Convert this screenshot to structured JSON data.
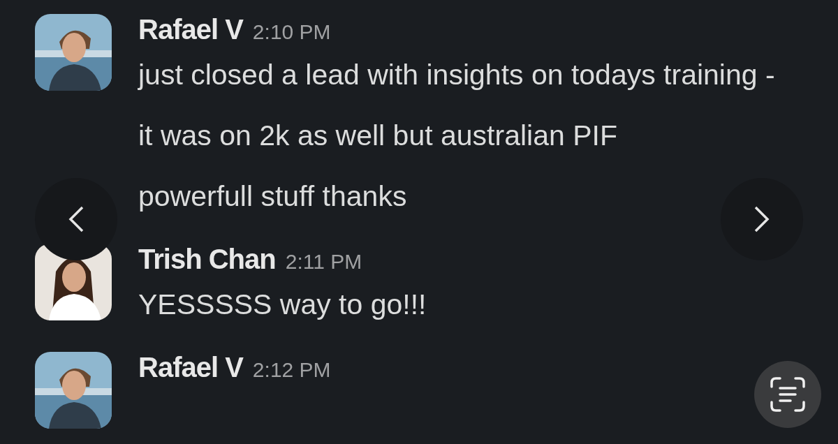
{
  "messages": [
    {
      "author": "Rafael V",
      "time": "2:10 PM",
      "lines": [
        "just closed a lead with insights on todays training -",
        "it was on 2k as well but australian PIF",
        "powerfull stuff thanks"
      ]
    },
    {
      "author": "Trish Chan",
      "time": "2:11 PM",
      "lines": [
        "YESSSSS way to go!!!"
      ]
    },
    {
      "author": "Rafael V",
      "time": "2:12 PM"
    }
  ]
}
